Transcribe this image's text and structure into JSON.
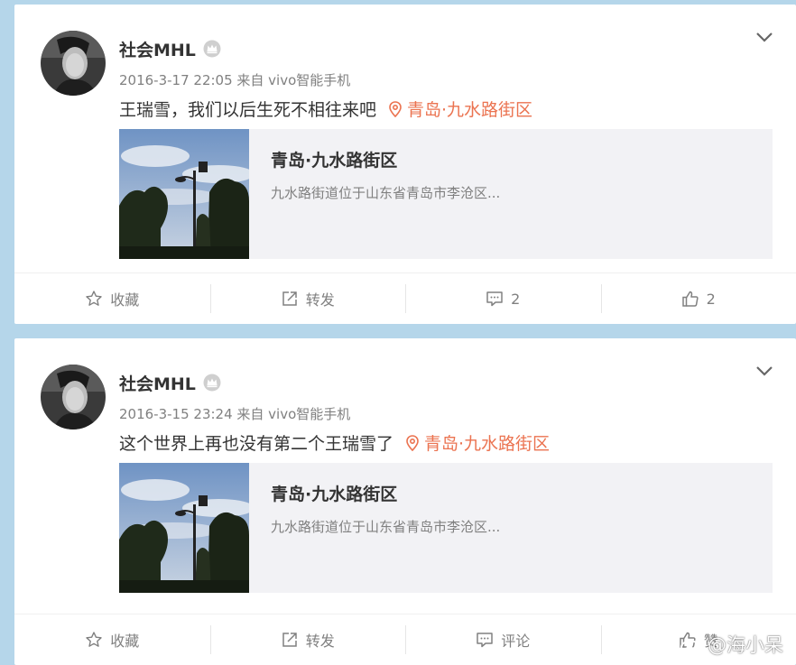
{
  "posts": [
    {
      "username": "社会MHL",
      "meta": "2016-3-17 22:05 来自 vivo智能手机",
      "text": "王瑞雪，我们以后生死不相往来吧",
      "location": "青岛·九水路街区",
      "card_title": "青岛·九水路街区",
      "card_desc": "九水路街道位于山东省青岛市李沧区...",
      "actions": {
        "fav": "收藏",
        "repost": "转发",
        "comment": "2",
        "like": "2"
      }
    },
    {
      "username": "社会MHL",
      "meta": "2016-3-15 23:24 来自 vivo智能手机",
      "text": "这个世界上再也没有第二个王瑞雪了",
      "location": "青岛·九水路街区",
      "card_title": "青岛·九水路街区",
      "card_desc": "九水路街道位于山东省青岛市李沧区...",
      "actions": {
        "fav": "收藏",
        "repost": "转发",
        "comment": "评论",
        "like": "赞"
      }
    }
  ],
  "watermark": "@海小呆",
  "colors": {
    "accent": "#eb7350",
    "background": "#b5d6ea",
    "muted": "#808080"
  }
}
